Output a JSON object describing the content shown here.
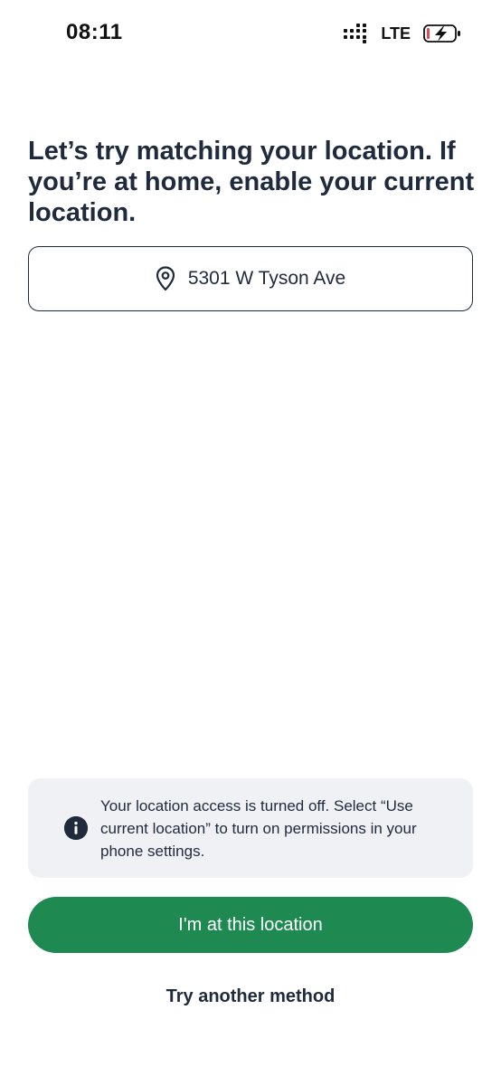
{
  "status_bar": {
    "time": "08:11",
    "network": "LTE",
    "signal_icon": "signal-bars-icon",
    "battery_icon": "battery-charging-icon"
  },
  "heading": "Let’s try matching your location. If you’re at home, enable your current location.",
  "address": {
    "icon": "location-pin-icon",
    "text": "5301 W Tyson Ave"
  },
  "notice": {
    "icon": "info-icon",
    "text": "Your location access is turned off. Select “Use current location” to turn on permissions in your phone settings."
  },
  "primary_button": {
    "label": "I'm at this location",
    "color": "#1e8a52"
  },
  "secondary_link": {
    "label": "Try another method"
  },
  "colors": {
    "text": "#1f2a3d",
    "notice_bg": "#f0f1f4",
    "battery_low": "#e5484d"
  }
}
